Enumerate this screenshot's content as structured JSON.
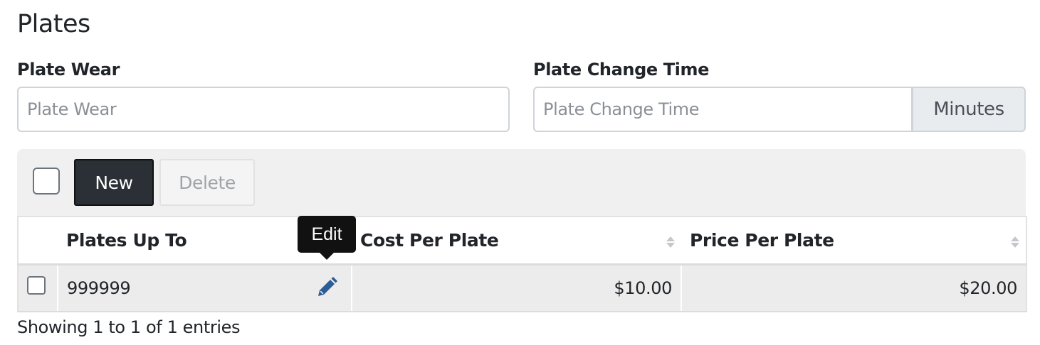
{
  "section": {
    "title": "Plates"
  },
  "fields": {
    "plate_wear": {
      "label": "Plate Wear",
      "placeholder": "Plate Wear",
      "value": ""
    },
    "plate_change_time": {
      "label": "Plate Change Time",
      "placeholder": "Plate Change Time",
      "value": "",
      "unit": "Minutes"
    }
  },
  "toolbar": {
    "new_label": "New",
    "delete_label": "Delete"
  },
  "table": {
    "columns": [
      "Plates Up To",
      "Cost Per Plate",
      "Price Per Plate"
    ],
    "rows": [
      {
        "plates_up_to": "999999",
        "cost_per_plate": "$10.00",
        "price_per_plate": "$20.00"
      }
    ]
  },
  "tooltip": {
    "text": "Edit"
  },
  "footer": {
    "info": "Showing 1 to 1 of 1 entries"
  },
  "colors": {
    "primary_button": "#2a3035",
    "edit_icon": "#2c5d96",
    "panel": "#f0f0f0"
  },
  "icons": {
    "edit": "pencil-icon",
    "sort": "sort-icon"
  }
}
